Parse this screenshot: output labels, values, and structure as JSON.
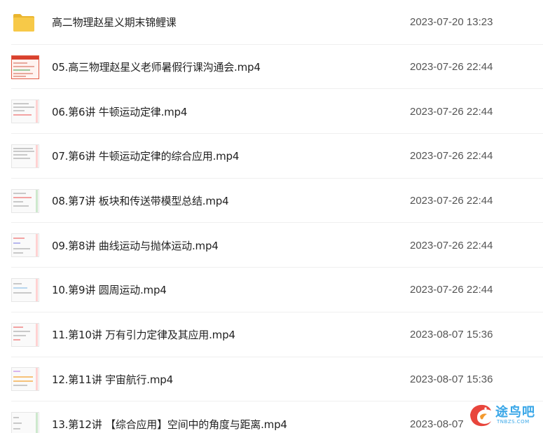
{
  "files": [
    {
      "name": "高二物理赵星义期末锦鲤课",
      "date": "2023-07-20 13:23",
      "icon": "folder-icon"
    },
    {
      "name": "05.高三物理赵星义老师暑假行课沟通会.mp4",
      "date": "2023-07-26 22:44",
      "icon": "video-thumbnail"
    },
    {
      "name": "06.第6讲 牛顿运动定律.mp4",
      "date": "2023-07-26 22:44",
      "icon": "video-thumbnail"
    },
    {
      "name": "07.第6讲 牛顿运动定律的综合应用.mp4",
      "date": "2023-07-26 22:44",
      "icon": "video-thumbnail"
    },
    {
      "name": "08.第7讲 板块和传送带模型总结.mp4",
      "date": "2023-07-26 22:44",
      "icon": "video-thumbnail"
    },
    {
      "name": "09.第8讲 曲线运动与抛体运动.mp4",
      "date": "2023-07-26 22:44",
      "icon": "video-thumbnail"
    },
    {
      "name": "10.第9讲 圆周运动.mp4",
      "date": "2023-07-26 22:44",
      "icon": "video-thumbnail"
    },
    {
      "name": "11.第10讲 万有引力定律及其应用.mp4",
      "date": "2023-08-07 15:36",
      "icon": "video-thumbnail"
    },
    {
      "name": "12.第11讲 宇宙航行.mp4",
      "date": "2023-08-07 15:36",
      "icon": "video-thumbnail"
    },
    {
      "name": "13.第12讲 【综合应用】空间中的角度与距离.mp4",
      "date": "2023-08-07",
      "icon": "video-thumbnail"
    }
  ],
  "watermark": {
    "text": "途鸟吧",
    "sub": "TNBZS.COM"
  },
  "colors": {
    "folder": "#f7c948",
    "folder_dark": "#eab52f",
    "watermark": "#3aa7e8",
    "watermark_logo": "#e8453c"
  }
}
